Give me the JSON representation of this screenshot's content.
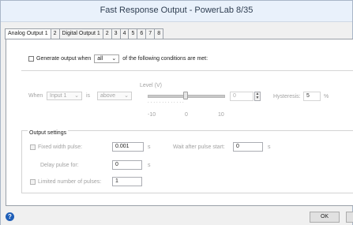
{
  "window": {
    "title": "Fast Response Output - PowerLab 8/35"
  },
  "tabs": [
    {
      "label": "Analog Output 1",
      "active": true
    },
    {
      "label": "2"
    },
    {
      "label": "Digital Output 1"
    },
    {
      "label": "2"
    },
    {
      "label": "3"
    },
    {
      "label": "4"
    },
    {
      "label": "5"
    },
    {
      "label": "6"
    },
    {
      "label": "7"
    },
    {
      "label": "8"
    }
  ],
  "generate": {
    "prefix": "Generate output when",
    "mode": "all",
    "suffix": "of the following conditions are met:"
  },
  "condition": {
    "when_label": "When",
    "input": "Input 1",
    "is_label": "is",
    "comparator": "above",
    "level_label": "Level (V)",
    "level_value": "0",
    "scale_min": "-10",
    "scale_mid": "0",
    "scale_max": "10",
    "hysteresis_label": "Hysteresis:",
    "hysteresis_value": "5",
    "hysteresis_unit": "%"
  },
  "output_settings": {
    "title": "Output settings",
    "fixed_width_label": "Fixed width pulse:",
    "fixed_width_value": "0.001",
    "fixed_width_unit": "s",
    "wait_label": "Wait after pulse start:",
    "wait_value": "0",
    "wait_unit": "s",
    "delay_label": "Delay pulse for:",
    "delay_value": "0",
    "delay_unit": "s",
    "limited_label": "Limited number of pulses:",
    "limited_value": "1"
  },
  "buttons": {
    "ok": "OK"
  },
  "icons": {
    "help": "help-icon",
    "accent": "#1f5fb8"
  }
}
